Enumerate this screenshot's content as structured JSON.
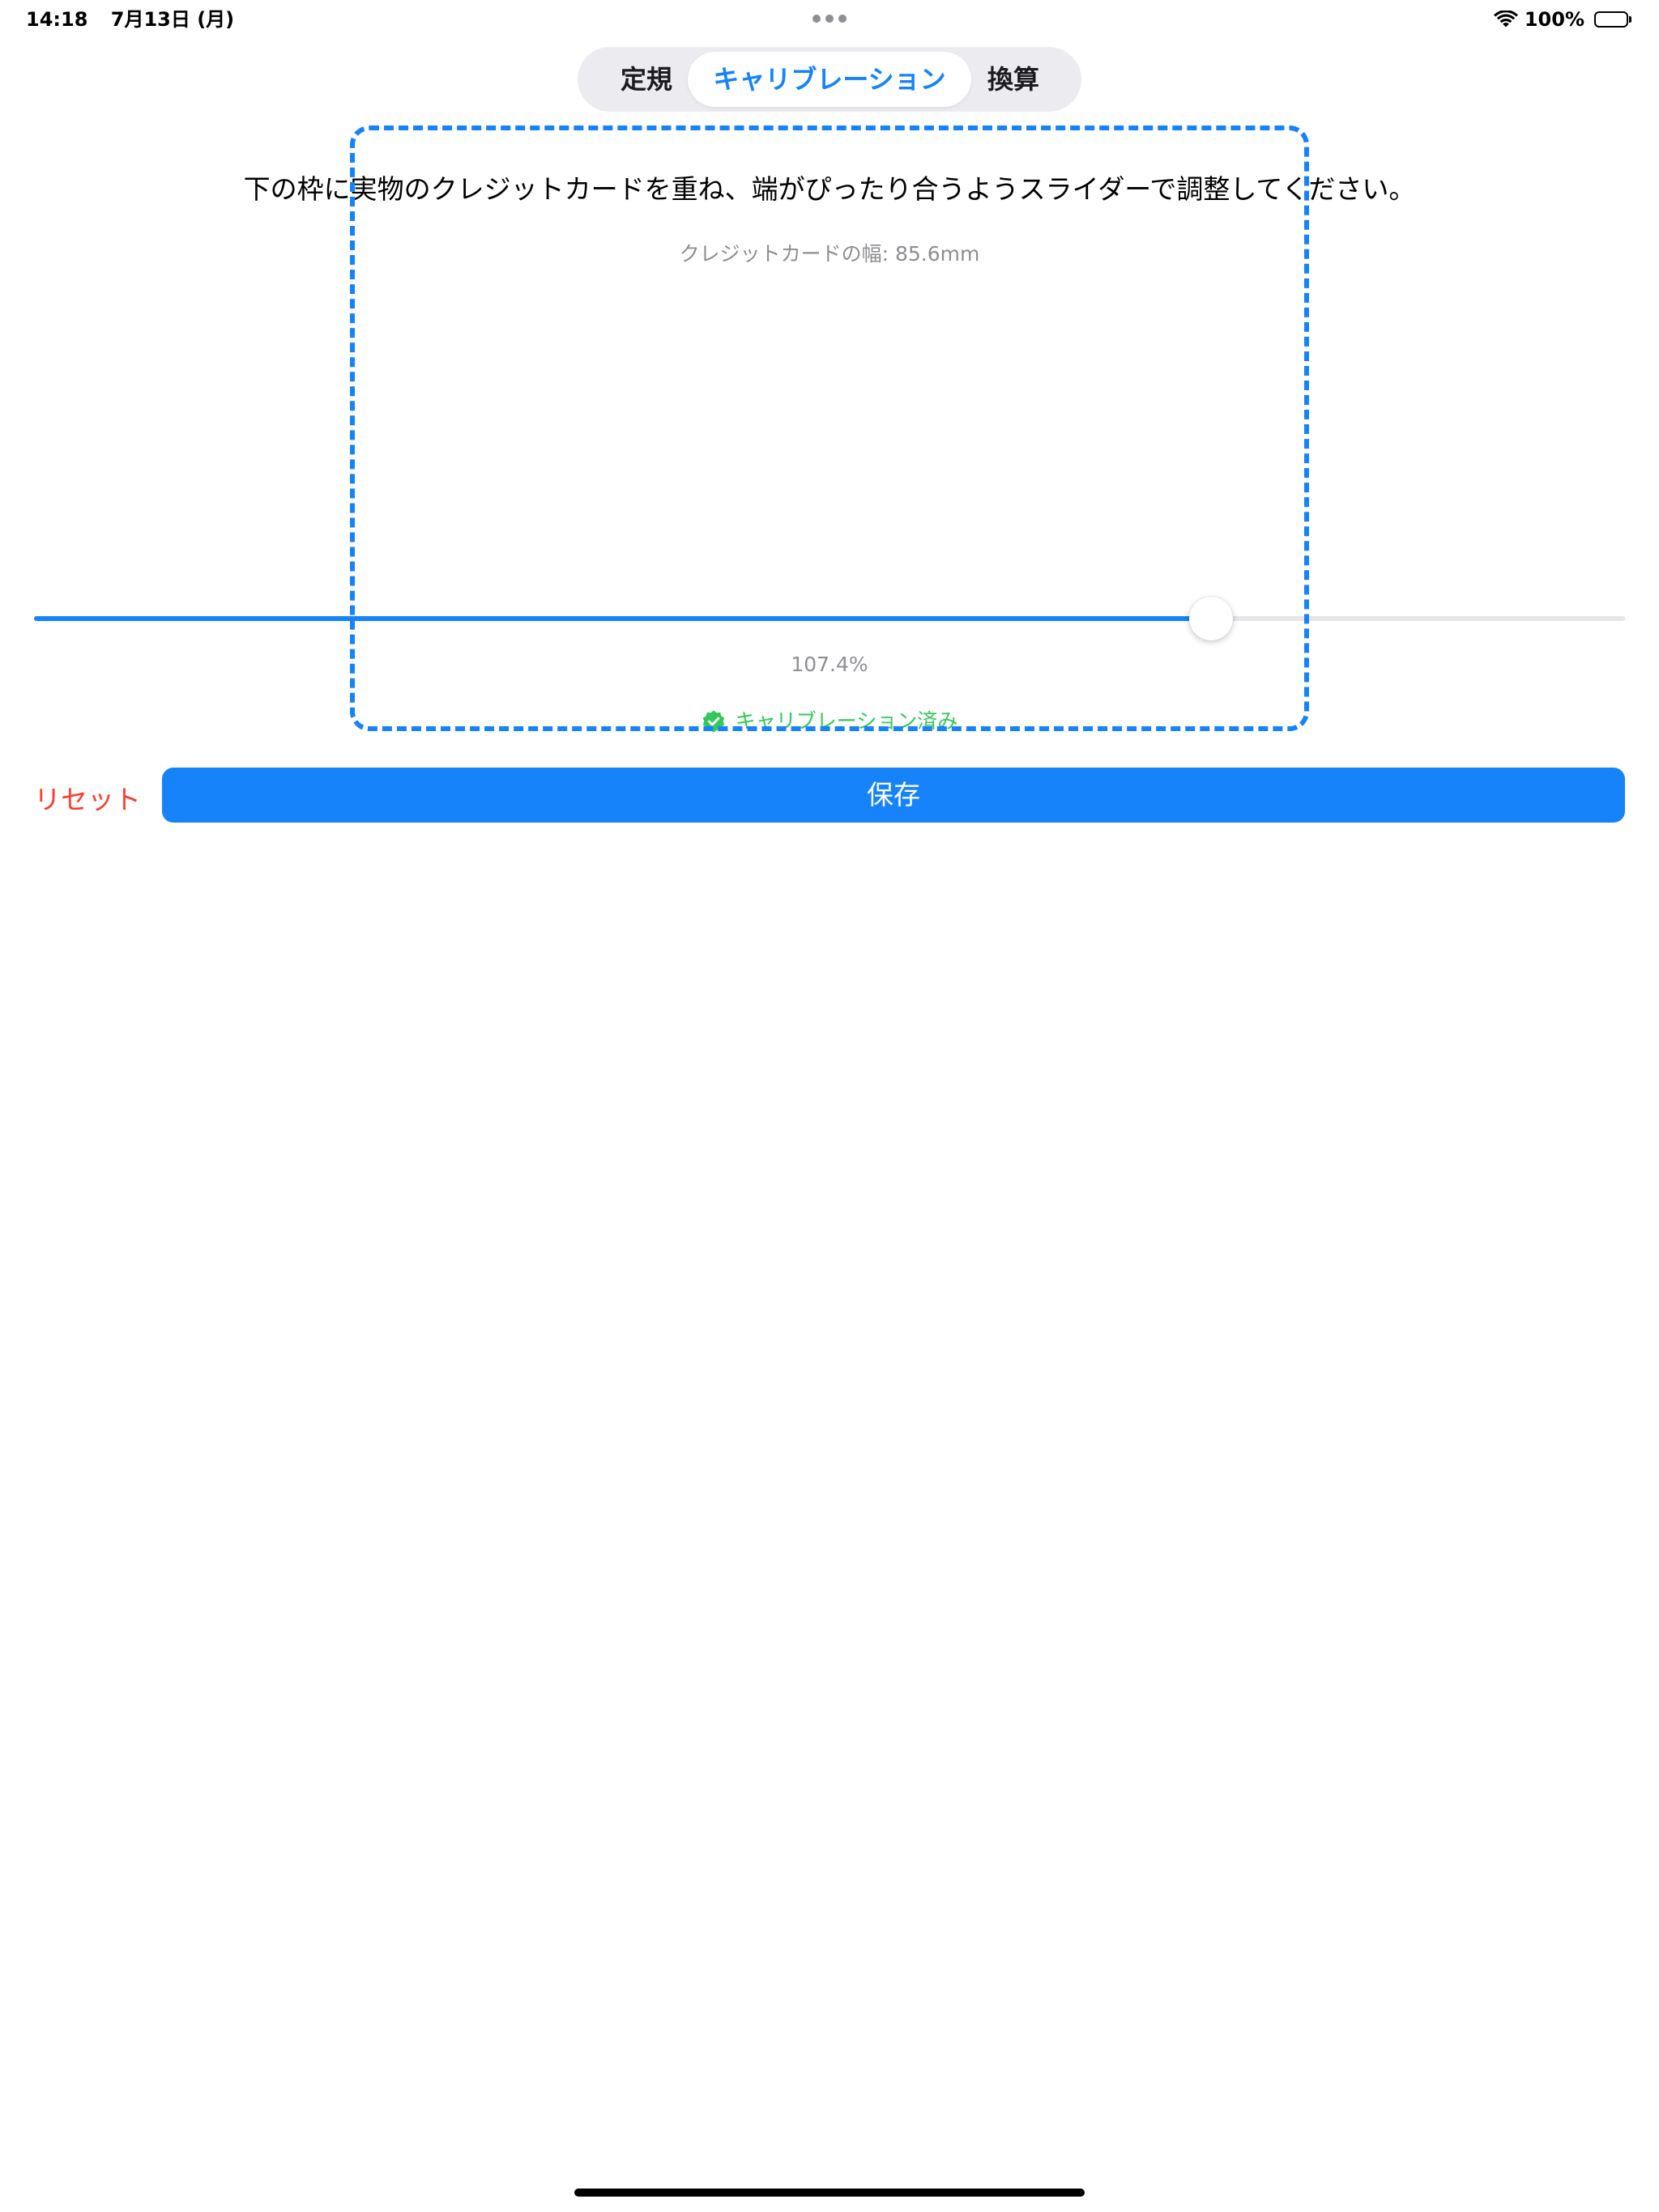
{
  "status_bar": {
    "time": "14:18",
    "date": "7月13日 (月)",
    "battery_percent": "100%",
    "battery_level": 1.0,
    "icons": [
      "multitask-dots-icon",
      "wifi-icon",
      "battery-icon"
    ]
  },
  "segments": {
    "items": [
      {
        "label": "定規"
      },
      {
        "label": "キャリブレーション"
      },
      {
        "label": "換算"
      }
    ],
    "selected_index": 1
  },
  "calibration": {
    "instruction": "下の枠に実物のクレジットカードを重ね、端がぴったり合うようスライダーで調整してください。",
    "card_width_info": "クレジットカードの幅: 85.6mm",
    "slider_fraction": 0.74,
    "scale_percent": "107.4%",
    "status_label": "キャリブレーション済み",
    "status_icon": "check-badge-icon"
  },
  "actions": {
    "reset_label": "リセット",
    "save_label": "保存"
  },
  "colors": {
    "accent": "#1683fb",
    "destructive": "#ff3b30",
    "success": "#34c759",
    "secondary_text": "#8e8e93"
  }
}
